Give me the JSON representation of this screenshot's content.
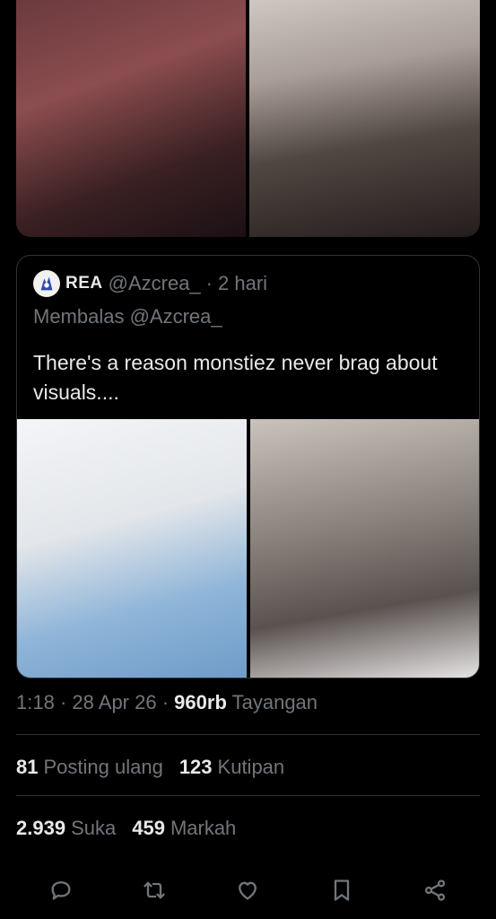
{
  "media_top": [
    {
      "alt": "photo-woman-glasses"
    },
    {
      "alt": "photo-woman-long-hair"
    }
  ],
  "quote": {
    "name": "REA",
    "handle": "@Azcrea_",
    "sep": "·",
    "time": "2 hari",
    "reply_label": "Membalas @Azcrea_",
    "text": "There's a reason monstiez never brag about visuals...."
  },
  "meta": {
    "time": "1:18",
    "date": "28 Apr 26",
    "views_count": "960rb",
    "views_label": "Tayangan",
    "sep": "·"
  },
  "stats_row1": {
    "reposts_count": "81",
    "reposts_label": "Posting ulang",
    "quotes_count": "123",
    "quotes_label": "Kutipan"
  },
  "stats_row2": {
    "likes_count": "2.939",
    "likes_label": "Suka",
    "bookmarks_count": "459",
    "bookmarks_label": "Markah"
  },
  "actions": [
    "reply-icon",
    "repost-icon",
    "like-icon",
    "bookmark-icon",
    "share-icon"
  ],
  "colors": {
    "background": "#000000",
    "text": "#e7e9ea",
    "muted": "#71767b",
    "border": "#2f3336"
  }
}
